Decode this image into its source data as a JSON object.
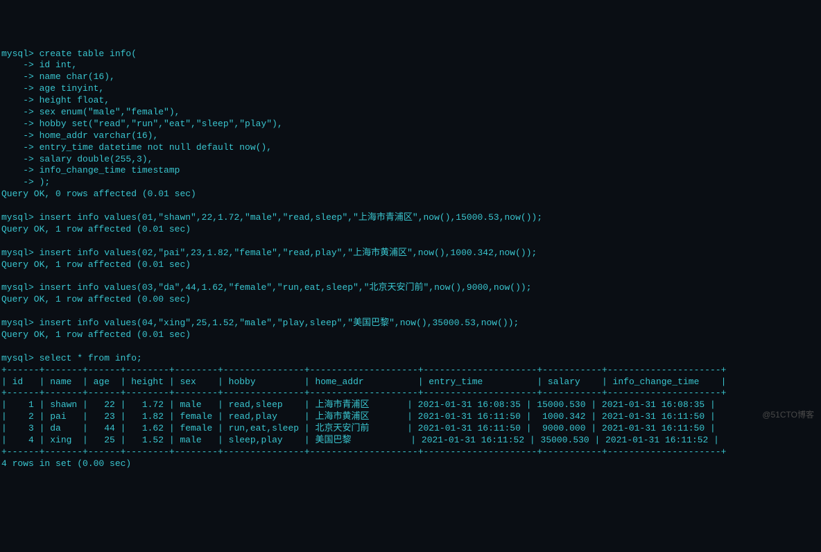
{
  "prompt": "mysql>",
  "cont": "    ->",
  "create_lines": [
    " create table info(",
    " id int,",
    " name char(16),",
    " age tinyint,",
    " height float,",
    " sex enum(\"male\",\"female\"),",
    " hobby set(\"read\",\"run\",\"eat\",\"sleep\",\"play\"),",
    " home_addr varchar(16),",
    " entry_time datetime not null default now(),",
    " salary double(255,3),",
    " info_change_time timestamp",
    " );"
  ],
  "create_result": "Query OK, 0 rows affected (0.01 sec)",
  "inserts": [
    {
      "cmd": " insert info values(01,\"shawn\",22,1.72,\"male\",\"read,sleep\",\"上海市青浦区\",now(),15000.53,now());",
      "result": "Query OK, 1 row affected (0.01 sec)"
    },
    {
      "cmd": " insert info values(02,\"pai\",23,1.82,\"female\",\"read,play\",\"上海市黄浦区\",now(),1000.342,now());",
      "result": "Query OK, 1 row affected (0.01 sec)"
    },
    {
      "cmd": " insert info values(03,\"da\",44,1.62,\"female\",\"run,eat,sleep\",\"北京天安门前\",now(),9000,now());",
      "result": "Query OK, 1 row affected (0.00 sec)"
    },
    {
      "cmd": " insert info values(04,\"xing\",25,1.52,\"male\",\"play,sleep\",\"美国巴黎\",now(),35000.53,now());",
      "result": "Query OK, 1 row affected (0.01 sec)"
    }
  ],
  "select_cmd": " select * from info;",
  "table": {
    "sep": "+------+-------+------+--------+--------+---------------+--------------------+---------------------+-----------+---------------------+",
    "header": "| id   | name  | age  | height | sex    | hobby         | home_addr          | entry_time          | salary    | info_change_time    |",
    "rows": [
      "|    1 | shawn |   22 |   1.72 | male   | read,sleep    | 上海市青浦区       | 2021-01-31 16:08:35 | 15000.530 | 2021-01-31 16:08:35 |",
      "|    2 | pai   |   23 |   1.82 | female | read,play     | 上海市黄浦区       | 2021-01-31 16:11:50 |  1000.342 | 2021-01-31 16:11:50 |",
      "|    3 | da    |   44 |   1.62 | female | run,eat,sleep | 北京天安门前       | 2021-01-31 16:11:50 |  9000.000 | 2021-01-31 16:11:50 |",
      "|    4 | xing  |   25 |   1.52 | male   | sleep,play    | 美国巴黎           | 2021-01-31 16:11:52 | 35000.530 | 2021-01-31 16:11:52 |"
    ]
  },
  "rows_result": "4 rows in set (0.00 sec)",
  "watermark": "@51CTO博客"
}
